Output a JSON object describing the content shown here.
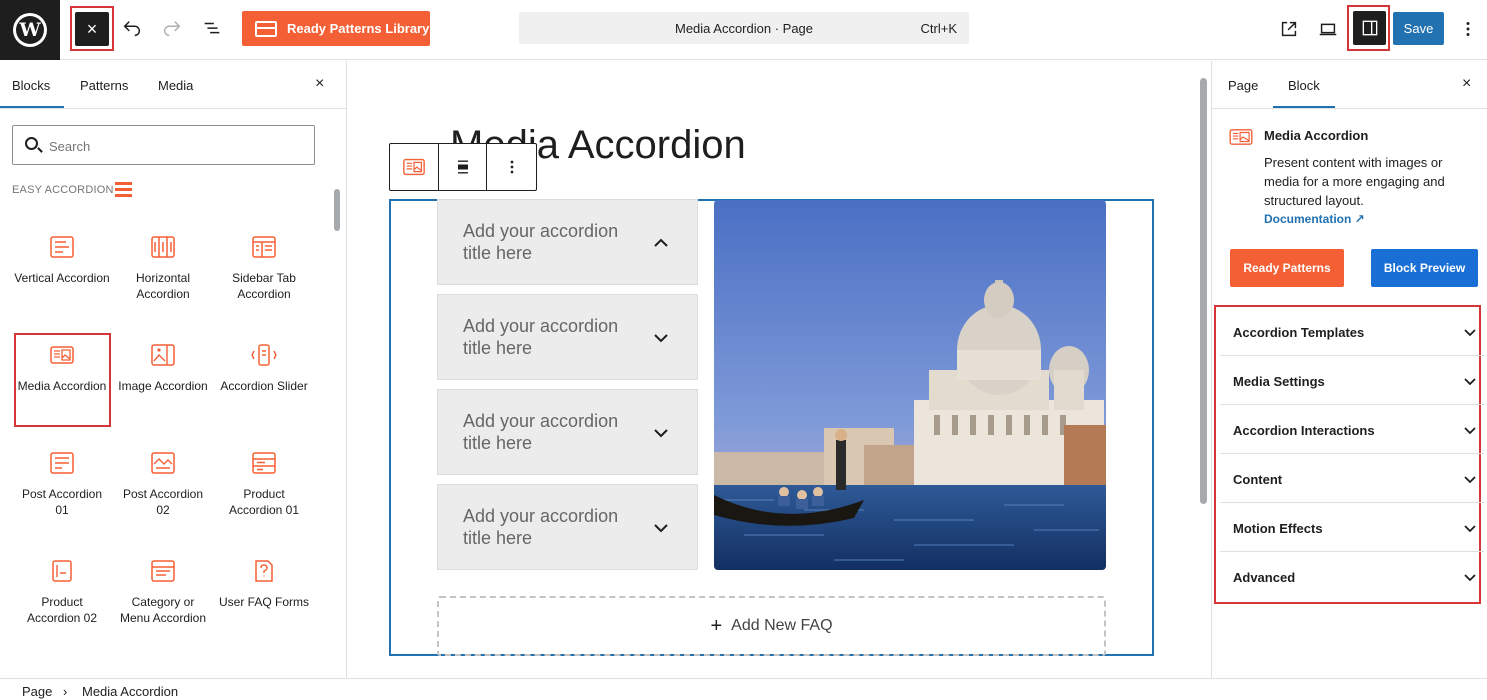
{
  "topbar": {
    "close_label": "×",
    "ready_patterns_label": "Ready Patterns Library",
    "command_title": "Media Accordion · Page",
    "command_shortcut": "Ctrl+K",
    "save_label": "Save"
  },
  "left_panel": {
    "tabs": [
      {
        "label": "Blocks"
      },
      {
        "label": "Patterns"
      },
      {
        "label": "Media"
      }
    ],
    "close_label": "×",
    "search_placeholder": "Search",
    "category": "EASY ACCORDION",
    "blocks": [
      {
        "label": "Vertical Accordion",
        "icon": "vertical-accordion-icon"
      },
      {
        "label": "Horizontal Accordion",
        "icon": "horizontal-accordion-icon"
      },
      {
        "label": "Sidebar Tab Accordion",
        "icon": "sidebar-tab-accordion-icon"
      },
      {
        "label": "Media Accordion",
        "icon": "media-accordion-icon"
      },
      {
        "label": "Image Accordion",
        "icon": "image-accordion-icon"
      },
      {
        "label": "Accordion Slider",
        "icon": "accordion-slider-icon"
      },
      {
        "label": "Post Accordion 01",
        "icon": "post-accordion-icon"
      },
      {
        "label": "Post Accordion 02",
        "icon": "post-accordion-icon"
      },
      {
        "label": "Product Accordion 01",
        "icon": "product-accordion-icon"
      },
      {
        "label": "Product Accordion 02",
        "icon": "product-accordion-icon"
      },
      {
        "label": "Category or Menu Accordion",
        "icon": "category-accordion-icon"
      },
      {
        "label": "User FAQ Forms",
        "icon": "faq-form-icon"
      }
    ]
  },
  "canvas": {
    "page_title": "Media Accordion",
    "accordion_items": [
      {
        "title": "Add your accordion title here",
        "state": "expanded"
      },
      {
        "title": "Add your accordion title here",
        "state": "collapsed"
      },
      {
        "title": "Add your accordion title here",
        "state": "collapsed"
      },
      {
        "title": "Add your accordion title here",
        "state": "collapsed"
      }
    ],
    "add_faq_label": "Add New FAQ"
  },
  "right_panel": {
    "tabs": [
      {
        "label": "Page"
      },
      {
        "label": "Block"
      }
    ],
    "close_label": "×",
    "block_name": "Media Accordion",
    "block_description": "Present content with images or media for a more engaging and structured layout.",
    "documentation_label": "Documentation ↗",
    "ready_patterns_label": "Ready Patterns",
    "block_preview_label": "Block Preview",
    "sections": [
      {
        "label": "Accordion Templates"
      },
      {
        "label": "Media Settings"
      },
      {
        "label": "Accordion Interactions"
      },
      {
        "label": "Content"
      },
      {
        "label": "Motion Effects"
      },
      {
        "label": "Advanced"
      }
    ]
  },
  "breadcrumb": {
    "root": "Page",
    "separator": "›",
    "current": "Media Accordion"
  },
  "colors": {
    "accent": "#f55f35",
    "primary": "#2271b1",
    "highlight": "#d63638"
  }
}
